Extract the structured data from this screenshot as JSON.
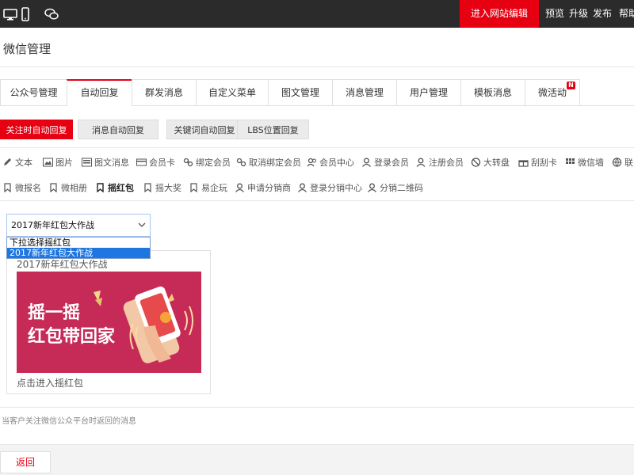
{
  "topbar": {
    "enter_label": "进入网站编辑",
    "links": [
      "预览",
      "升级",
      "发布",
      "帮助"
    ]
  },
  "page_title": "微信管理",
  "tabs": [
    "公众号管理",
    "自动回复",
    "群发消息",
    "自定义菜单",
    "图文管理",
    "消息管理",
    "用户管理",
    "模板消息",
    "微活动"
  ],
  "tab_badge": "N",
  "active_tab": "自动回复",
  "subtabs": [
    "关注时自动回复",
    "消息自动回复",
    "关键词自动回复",
    "LBS位置回复"
  ],
  "toolbar_row1": [
    "文本",
    "图片",
    "图文消息",
    "会员卡",
    "绑定会员",
    "取消绑定会员",
    "会员中心",
    "登录会员",
    "注册会员",
    "大转盘",
    "刮刮卡",
    "微信墙",
    "联系"
  ],
  "toolbar_row2": [
    "微报名",
    "微相册",
    "摇红包",
    "摇大奖",
    "易企玩",
    "申请分销商",
    "登录分销中心",
    "分销二维码"
  ],
  "select": {
    "value": "2017新年红包大作战",
    "options": [
      "下拉选择摇红包",
      "2017新年红包大作战"
    ]
  },
  "card": {
    "title": "2017新年红包大作战",
    "banner_line1": "摇一摇",
    "banner_line2": "红包带回家",
    "link": "点击进入摇红包"
  },
  "note": "当客户关注微信公众平台时返回的消息",
  "back_label": "返回",
  "colors": {
    "accent": "#e60012",
    "topbar": "#2b2b2b",
    "banner": "#c62a57",
    "select_highlight": "#1e76e0"
  }
}
